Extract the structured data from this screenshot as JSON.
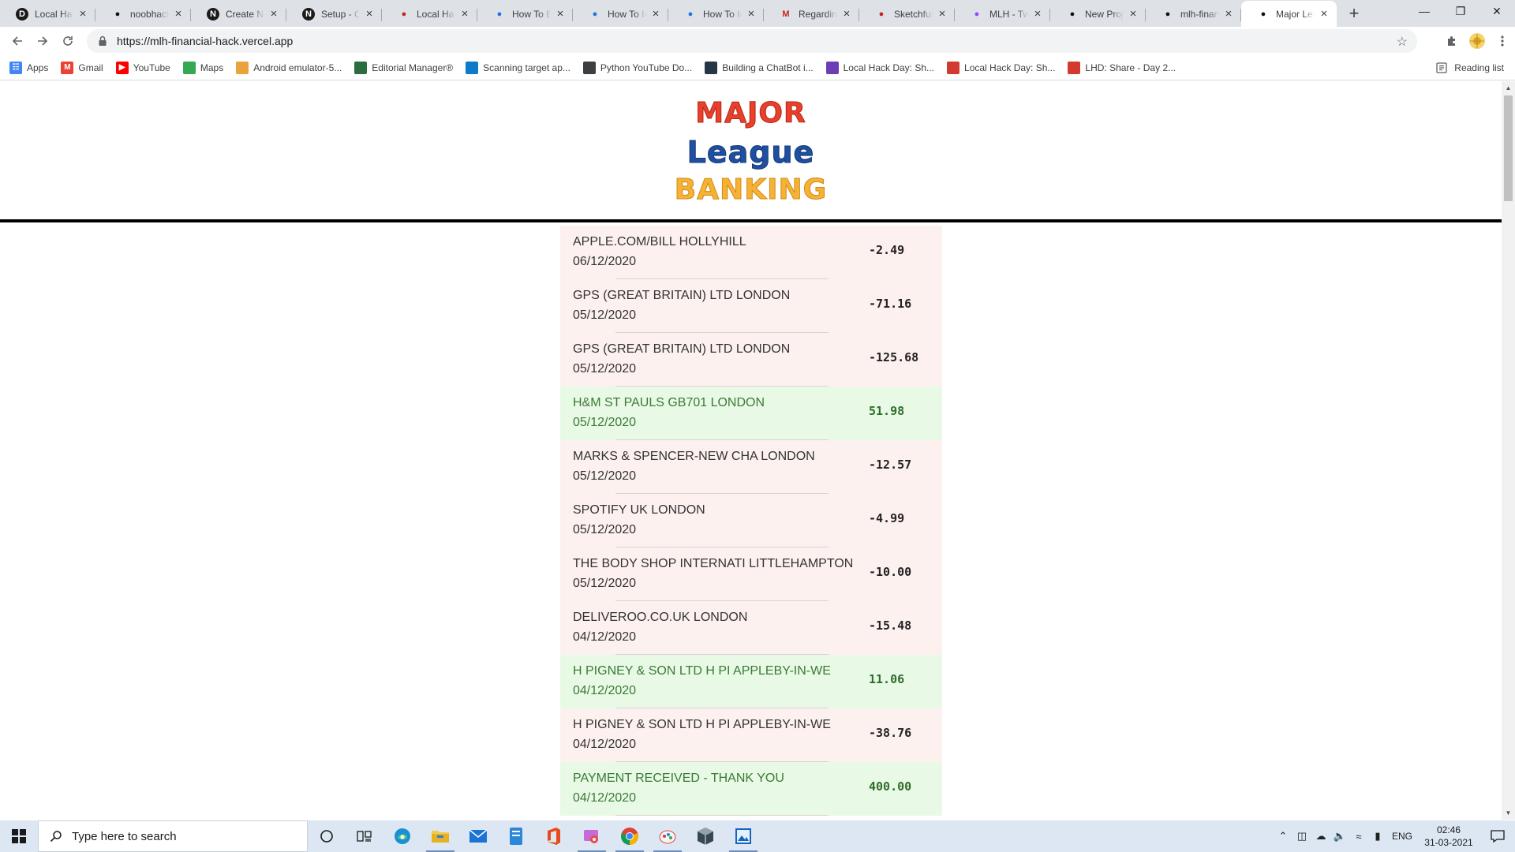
{
  "browser": {
    "tabs": [
      {
        "title": "Local Hack Day",
        "icon": "devpost-icon",
        "icon_char": "D",
        "icon_bg": "#1a1a1a"
      },
      {
        "title": "noobhacker",
        "icon": "github-icon",
        "icon_char": "",
        "icon_bg": "#1a1a1a"
      },
      {
        "title": "Create New",
        "icon": "notion-icon",
        "icon_char": "N",
        "icon_bg": "#1a1a1a"
      },
      {
        "title": "Setup - Create",
        "icon": "notion-icon",
        "icon_char": "N",
        "icon_bg": "#1a1a1a"
      },
      {
        "title": "Local Hack Day",
        "icon": "pen-icon",
        "icon_char": "",
        "icon_bg": ""
      },
      {
        "title": "How To Build",
        "icon": "replit-icon",
        "icon_char": "",
        "icon_bg": ""
      },
      {
        "title": "How To Install",
        "icon": "replit-icon",
        "icon_char": "",
        "icon_bg": ""
      },
      {
        "title": "How To Install",
        "icon": "replit-icon",
        "icon_char": "",
        "icon_bg": ""
      },
      {
        "title": "Regarding",
        "icon": "gmail-icon",
        "icon_char": "M",
        "icon_bg": ""
      },
      {
        "title": "Sketchfull.io",
        "icon": "pen-icon",
        "icon_char": "",
        "icon_bg": ""
      },
      {
        "title": "MLH - Twitch",
        "icon": "twitch-icon",
        "icon_char": "",
        "icon_bg": ""
      },
      {
        "title": "New Project",
        "icon": "vercel-icon",
        "icon_char": "",
        "icon_bg": ""
      },
      {
        "title": "mlh-financial",
        "icon": "vercel-icon",
        "icon_char": "",
        "icon_bg": ""
      },
      {
        "title": "Major League",
        "icon": "vercel-icon",
        "icon_char": "",
        "icon_bg": "",
        "active": true
      }
    ],
    "url": "https://mlh-financial-hack.vercel.app",
    "bookmarks": [
      {
        "label": "Apps",
        "icon": "apps-grid-icon",
        "color": "#4285f4"
      },
      {
        "label": "Gmail",
        "icon": "gmail-icon",
        "color": "#ea4335"
      },
      {
        "label": "YouTube",
        "icon": "youtube-icon",
        "color": "#ff0000"
      },
      {
        "label": "Maps",
        "icon": "maps-icon",
        "color": "#34a853"
      },
      {
        "label": "Android emulator-5...",
        "icon": "android-emulator-icon",
        "color": "#e8a33d"
      },
      {
        "label": "Editorial Manager®",
        "icon": "editorial-manager-icon",
        "color": "#2a6e3f"
      },
      {
        "label": "Scanning target ap...",
        "icon": "scanning-icon",
        "color": "#0a7ac9"
      },
      {
        "label": "Python YouTube Do...",
        "icon": "python-icon",
        "color": "#3c4043"
      },
      {
        "label": "Building a ChatBot i...",
        "icon": "chatbot-icon",
        "color": "#253746"
      },
      {
        "label": "Local Hack Day: Sh...",
        "icon": "list-icon",
        "color": "#6a3fb5"
      },
      {
        "label": "Local Hack Day: Sh...",
        "icon": "pen-icon",
        "color": "#d33a2f"
      },
      {
        "label": "LHD: Share - Day 2...",
        "icon": "pen-icon",
        "color": "#d33a2f"
      }
    ],
    "reading_list": "Reading list"
  },
  "site": {
    "logo": {
      "line1": "MAJOR",
      "line2": "League",
      "line3": "BANKING"
    },
    "colors": {
      "debit_bg": "#fdf1f0",
      "credit_bg": "#e8f9e6",
      "credit_text": "#3b7a34"
    },
    "transactions": [
      {
        "description": "APPLE.COM/BILL HOLLYHILL",
        "date": "06/12/2020",
        "amount": "-2.49",
        "type": "debit"
      },
      {
        "description": "GPS (GREAT BRITAIN) LTD LONDON",
        "date": "05/12/2020",
        "amount": "-71.16",
        "type": "debit"
      },
      {
        "description": "GPS (GREAT BRITAIN) LTD LONDON",
        "date": "05/12/2020",
        "amount": "-125.68",
        "type": "debit"
      },
      {
        "description": "H&M ST PAULS GB701 LONDON",
        "date": "05/12/2020",
        "amount": "51.98",
        "type": "credit"
      },
      {
        "description": "MARKS & SPENCER-NEW CHA LONDON",
        "date": "05/12/2020",
        "amount": "-12.57",
        "type": "debit"
      },
      {
        "description": "SPOTIFY UK LONDON",
        "date": "05/12/2020",
        "amount": "-4.99",
        "type": "debit"
      },
      {
        "description": "THE BODY SHOP INTERNATI LITTLEHAMPTON",
        "date": "05/12/2020",
        "amount": "-10.00",
        "type": "debit"
      },
      {
        "description": "DELIVEROO.CO.UK LONDON",
        "date": "04/12/2020",
        "amount": "-15.48",
        "type": "debit"
      },
      {
        "description": "H PIGNEY & SON LTD H PI APPLEBY-IN-WE",
        "date": "04/12/2020",
        "amount": "11.06",
        "type": "credit"
      },
      {
        "description": "H PIGNEY & SON LTD H PI APPLEBY-IN-WE",
        "date": "04/12/2020",
        "amount": "-38.76",
        "type": "debit"
      },
      {
        "description": "PAYMENT RECEIVED - THANK YOU",
        "date": "04/12/2020",
        "amount": "400.00",
        "type": "credit"
      }
    ]
  },
  "taskbar": {
    "search_placeholder": "Type here to search",
    "language": "ENG",
    "time": "02:46",
    "date": "31-03-2021"
  }
}
